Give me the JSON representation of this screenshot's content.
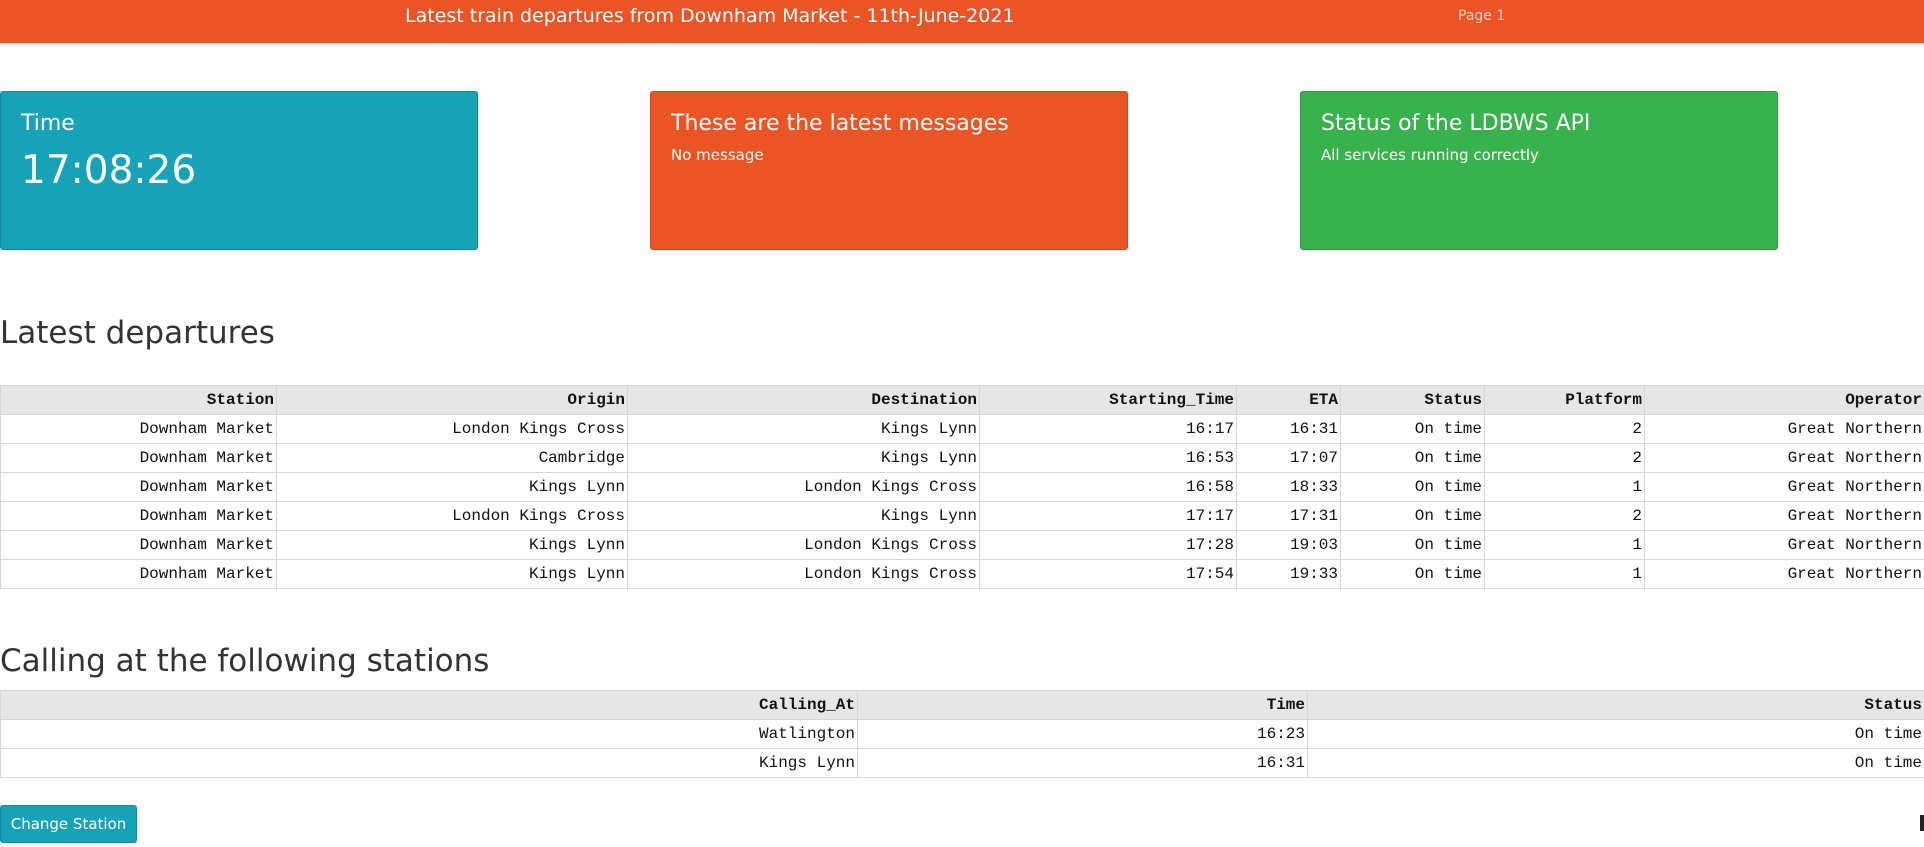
{
  "header": {
    "title": "Latest train departures from Downham Market - 11th-June-2021",
    "page_label": "Page 1",
    "background": "#eb5424"
  },
  "cards": {
    "time": {
      "title": "Time",
      "value": "17:08:26",
      "color": "#17a2b8"
    },
    "messages": {
      "title": "These are the latest messages",
      "text": "No message",
      "color": "#eb5424"
    },
    "api_status": {
      "title": "Status of the LDBWS API",
      "text": "All services running correctly",
      "color": "#37b24d"
    }
  },
  "departures": {
    "heading": "Latest departures",
    "columns": [
      "Station",
      "Origin",
      "Destination",
      "Starting_Time",
      "ETA",
      "Status",
      "Platform",
      "Operator"
    ],
    "rows": [
      [
        "Downham Market",
        "London Kings Cross",
        "Kings Lynn",
        "16:17",
        "16:31",
        "On time",
        "2",
        "Great Northern"
      ],
      [
        "Downham Market",
        "Cambridge",
        "Kings Lynn",
        "16:53",
        "17:07",
        "On time",
        "2",
        "Great Northern"
      ],
      [
        "Downham Market",
        "Kings Lynn",
        "London Kings Cross",
        "16:58",
        "18:33",
        "On time",
        "1",
        "Great Northern"
      ],
      [
        "Downham Market",
        "London Kings Cross",
        "Kings Lynn",
        "17:17",
        "17:31",
        "On time",
        "2",
        "Great Northern"
      ],
      [
        "Downham Market",
        "Kings Lynn",
        "London Kings Cross",
        "17:28",
        "19:03",
        "On time",
        "1",
        "Great Northern"
      ],
      [
        "Downham Market",
        "Kings Lynn",
        "London Kings Cross",
        "17:54",
        "19:33",
        "On time",
        "1",
        "Great Northern"
      ]
    ]
  },
  "calling": {
    "heading": "Calling at the following stations",
    "columns": [
      "Calling_At",
      "Time",
      "Status"
    ],
    "rows": [
      [
        "Watlington",
        "16:23",
        "On time"
      ],
      [
        "Kings Lynn",
        "16:31",
        "On time"
      ]
    ]
  },
  "actions": {
    "change_station_label": "Change Station"
  }
}
